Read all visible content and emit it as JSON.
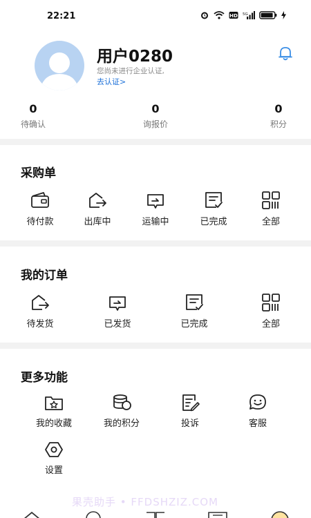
{
  "status_bar": {
    "time": "22:21"
  },
  "profile": {
    "username": "用户0280",
    "cert_note": "您尚未进行企业认证,",
    "cert_link": "去认证>",
    "stats": [
      {
        "value": "0",
        "label": "待确认"
      },
      {
        "value": "0",
        "label": "询报价"
      },
      {
        "value": "0",
        "label": "积分"
      }
    ]
  },
  "purchase": {
    "title": "采购单",
    "items": [
      {
        "label": "待付款",
        "icon": "wallet-icon"
      },
      {
        "label": "出库中",
        "icon": "outbound-icon"
      },
      {
        "label": "运输中",
        "icon": "transport-icon"
      },
      {
        "label": "已完成",
        "icon": "completed-icon"
      },
      {
        "label": "全部",
        "icon": "grid-icon"
      }
    ]
  },
  "orders": {
    "title": "我的订单",
    "items": [
      {
        "label": "待发货",
        "icon": "outbound-icon"
      },
      {
        "label": "已发货",
        "icon": "transport-icon"
      },
      {
        "label": "已完成",
        "icon": "completed-icon"
      },
      {
        "label": "全部",
        "icon": "grid-icon"
      }
    ]
  },
  "more": {
    "title": "更多功能",
    "items": [
      {
        "label": "我的收藏",
        "icon": "star-folder-icon"
      },
      {
        "label": "我的积分",
        "icon": "coins-icon"
      },
      {
        "label": "投诉",
        "icon": "complaint-icon"
      },
      {
        "label": "客服",
        "icon": "service-icon"
      },
      {
        "label": "设置",
        "icon": "settings-icon"
      }
    ]
  },
  "watermark": "果壳助手 • FFDSHZIZ.COM"
}
